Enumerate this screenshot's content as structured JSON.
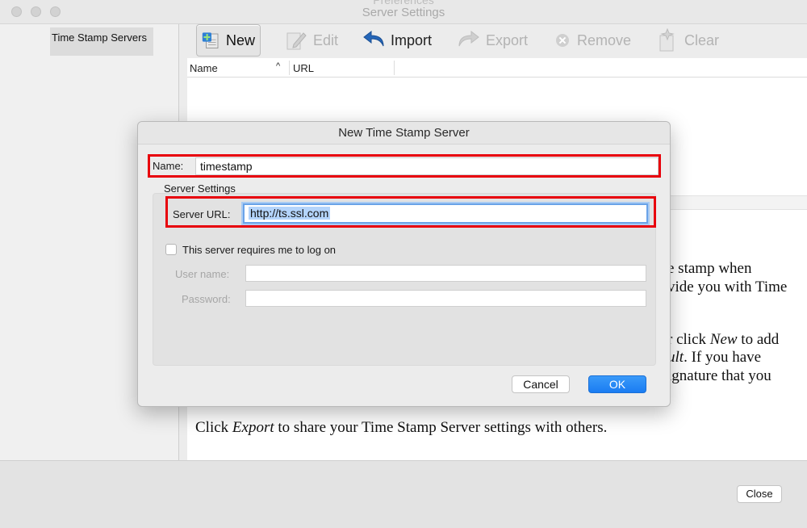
{
  "window": {
    "title": "Server Settings",
    "ghost_title": "Preferences"
  },
  "sidebar": {
    "items": [
      {
        "label": "Time Stamp Servers",
        "selected": true
      }
    ]
  },
  "toolbar": {
    "new_label": "New",
    "edit_label": "Edit",
    "import_label": "Import",
    "export_label": "Export",
    "remove_label": "Remove",
    "clear_label": "Clear"
  },
  "table": {
    "columns": [
      "Name",
      "URL"
    ],
    "sort_indicator": "^"
  },
  "help_text": {
    "line1_tail": "e stamp when",
    "line2_tail": "vide you with Time",
    "line3_tail_a": "r click ",
    "line3_tail_b": "New",
    "line3_tail_c": " to add",
    "line4_tail_a": "ult",
    "line4_tail_b": ". If you have",
    "line5_tail": "ignature that you",
    "export_a": "Click ",
    "export_b": "Export",
    "export_c": " to share your Time Stamp Server settings with others."
  },
  "dialog": {
    "title": "New Time Stamp Server",
    "name_label": "Name:",
    "name_value": "timestamp",
    "group_label": "Server Settings",
    "server_url_label": "Server URL:",
    "server_url_value": "http://ts.ssl.com",
    "logon_checkbox_label": "This server requires me to log on",
    "logon_checked": false,
    "username_label": "User name:",
    "password_label": "Password:",
    "cancel_label": "Cancel",
    "ok_label": "OK"
  },
  "footer": {
    "close_label": "Close"
  },
  "colors": {
    "highlight_red": "#e8000b",
    "accent_blue": "#1a7cf2",
    "selection_blue": "#b4d4fb"
  }
}
